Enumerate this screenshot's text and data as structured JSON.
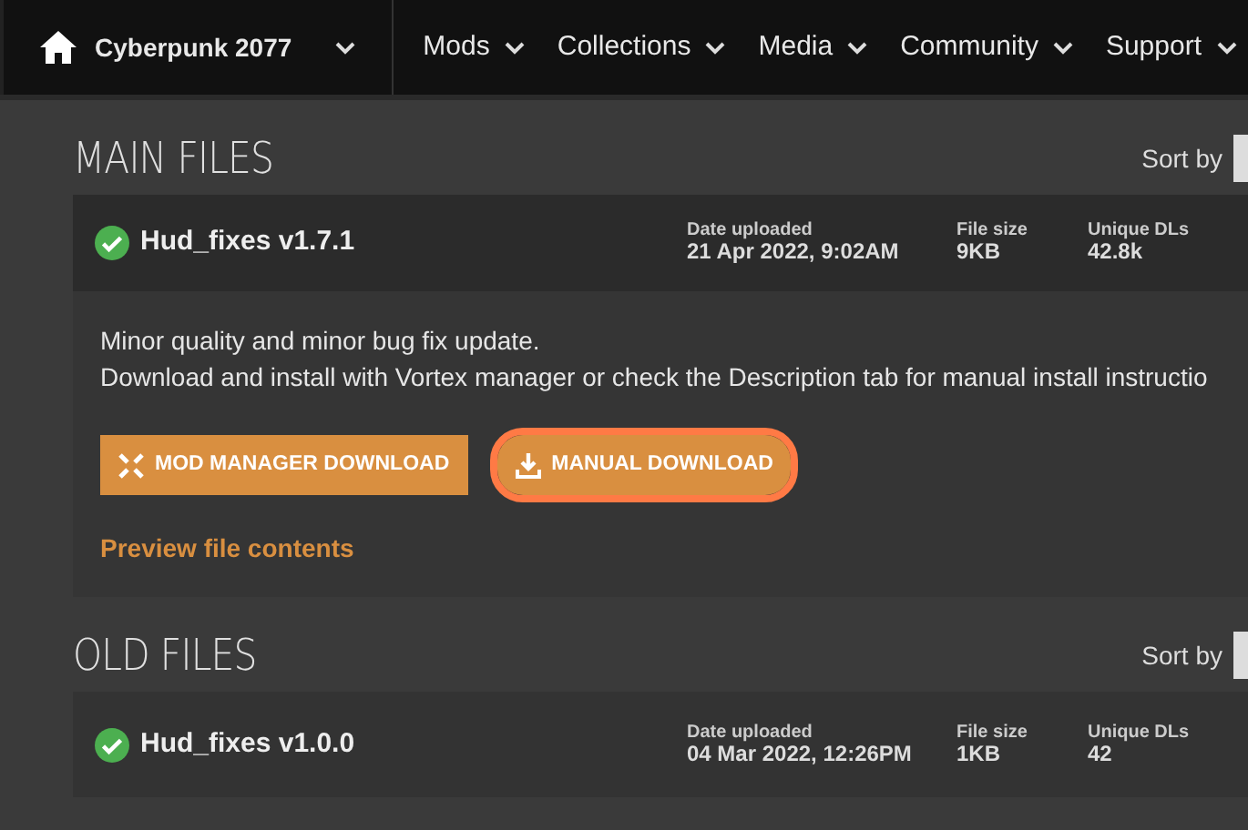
{
  "navbar": {
    "game": "Cyberpunk 2077",
    "items": [
      "Mods",
      "Collections",
      "Media",
      "Community",
      "Support"
    ]
  },
  "sections": [
    {
      "title": "MAIN FILES",
      "sort_label": "Sort by",
      "files": [
        {
          "name": "Hud_fixes v1.7.1",
          "verified": true,
          "stats": [
            {
              "label": "Date uploaded",
              "value": "21 Apr 2022, 9:02AM"
            },
            {
              "label": "File size",
              "value": "9KB"
            },
            {
              "label": "Unique DLs",
              "value": "42.8k"
            }
          ],
          "description": [
            "Minor quality and minor bug fix update.",
            "Download and install with Vortex manager or check the Description tab for manual install instructio"
          ],
          "buttons": [
            {
              "kind": "mod-manager",
              "label": "MOD MANAGER DOWNLOAD",
              "highlighted": false
            },
            {
              "kind": "manual",
              "label": "MANUAL DOWNLOAD",
              "highlighted": true
            }
          ],
          "preview_link": "Preview file contents"
        }
      ]
    },
    {
      "title": "OLD FILES",
      "sort_label": "Sort by",
      "files": [
        {
          "name": "Hud_fixes v1.0.0",
          "verified": true,
          "stats": [
            {
              "label": "Date uploaded",
              "value": "04 Mar 2022, 12:26PM"
            },
            {
              "label": "File size",
              "value": "1KB"
            },
            {
              "label": "Unique DLs",
              "value": "42"
            }
          ]
        }
      ]
    }
  ]
}
